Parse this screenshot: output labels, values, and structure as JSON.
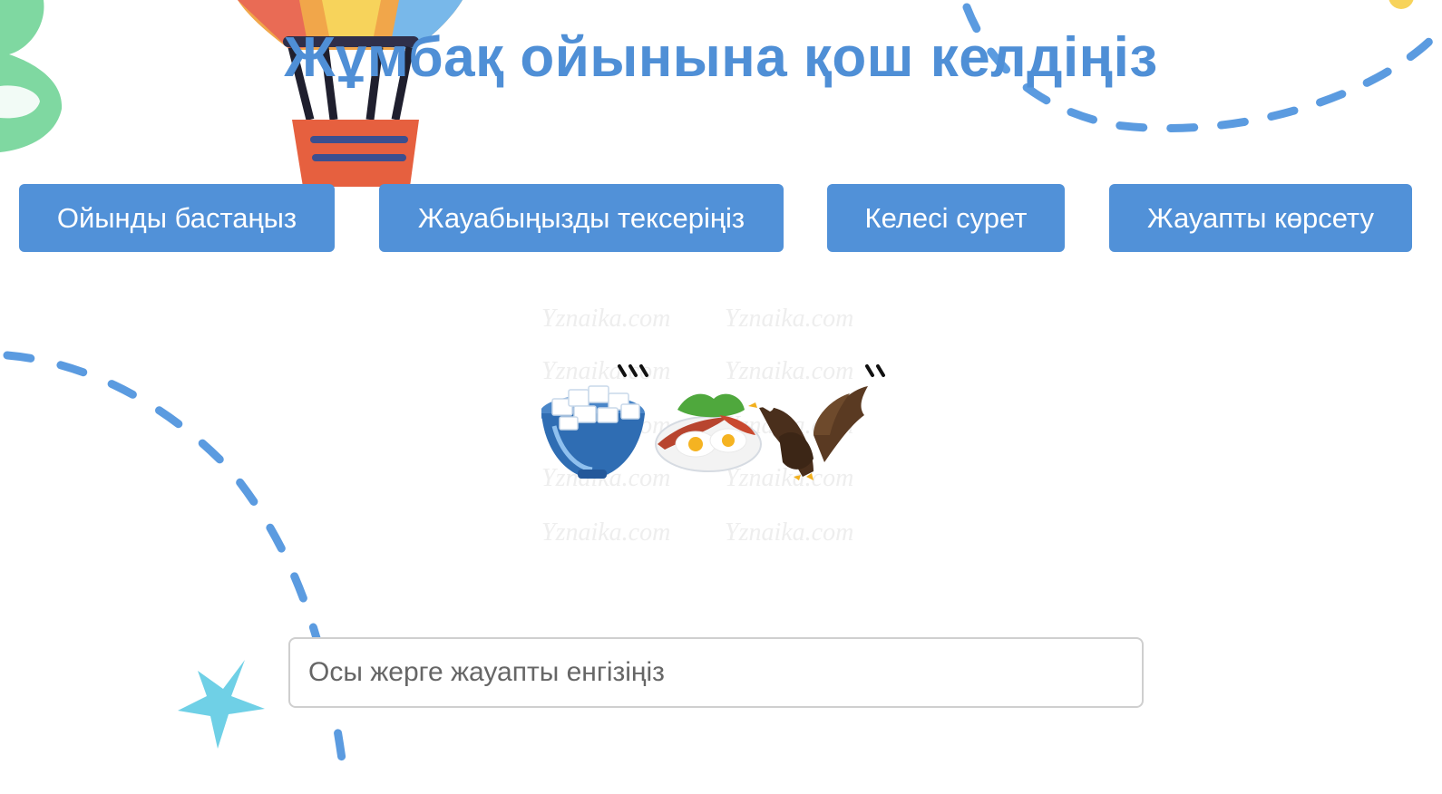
{
  "header": {
    "title": "Жұмбақ ойынына қош келдіңіз"
  },
  "buttons": {
    "start_label": "Ойынды бастаңыз",
    "check_label": "Жауабыңызды тексеріңіз",
    "next_label": "Келесі сурет",
    "show_label": "Жауапты көрсету"
  },
  "puzzle": {
    "watermark_text": "Yznaika.com",
    "images": [
      "sugar-bowl-icon",
      "fried-eggs-plate-icon",
      "eagle-icon"
    ],
    "marks": [
      "'''",
      "''"
    ]
  },
  "answer": {
    "placeholder": "Осы жерге жауапты енгізіңіз",
    "value": ""
  },
  "colors": {
    "accent": "#5191d8",
    "title": "#4f8fd6",
    "dash": "#5b9be0",
    "star": "#6fd0e6"
  }
}
